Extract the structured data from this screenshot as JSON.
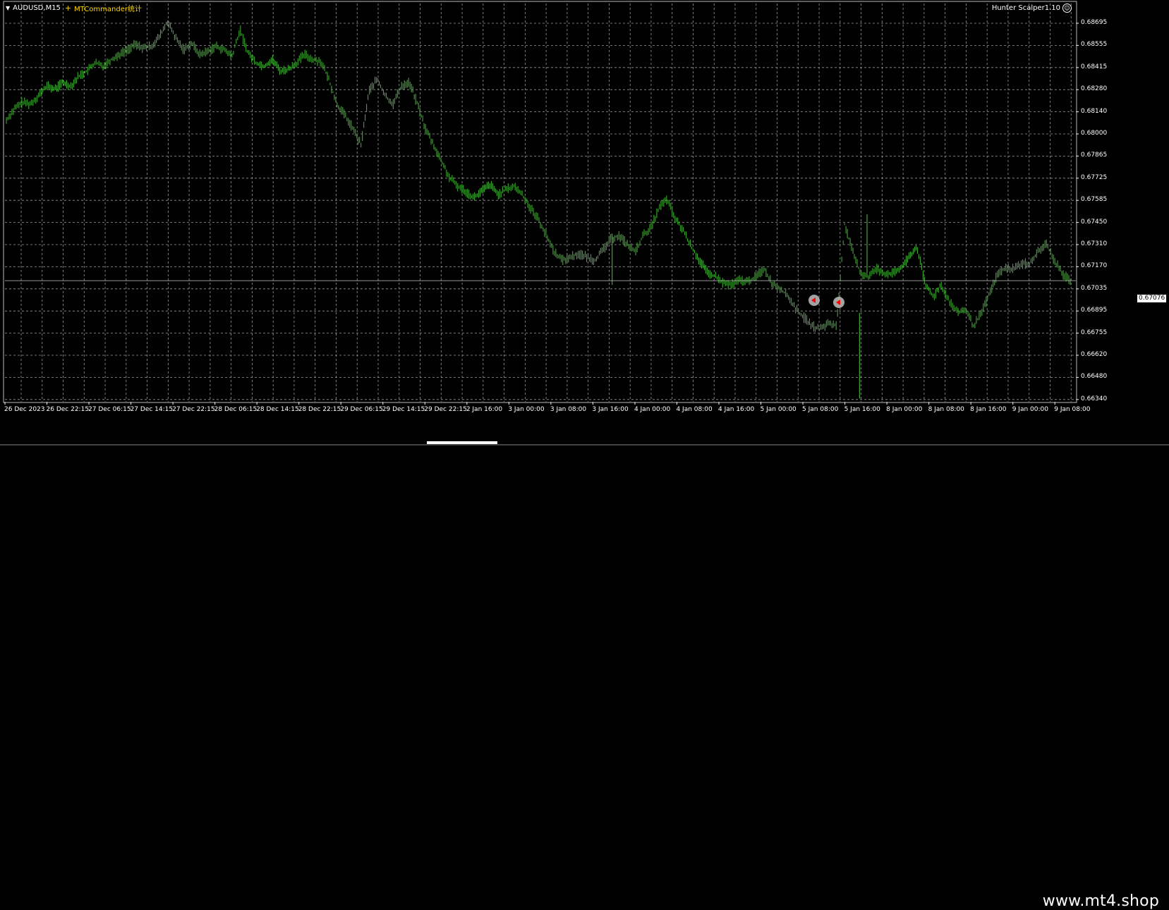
{
  "chart": {
    "symbol": "AUDUSD,M15",
    "expert_name": "MTCommander统计",
    "indicator_name": "Hunter Scalper1.10",
    "current_price": "0.67076",
    "colors": {
      "background": "#000000",
      "grid": "#9a9a9a",
      "candles": "#3fa832",
      "axis_text": "#ffffff",
      "expert_text": "#ffd700",
      "bid_line": "#aaaaaa",
      "trade_marker": "#c0c0c0",
      "trade_marker_arrow": "#ff0000"
    }
  },
  "chart_data": {
    "type": "line",
    "title": "",
    "ylim": [
      0.6634,
      0.6876
    ],
    "y_ticks": [
      "0.68695",
      "0.68555",
      "0.68415",
      "0.68280",
      "0.68140",
      "0.68000",
      "0.67865",
      "0.67725",
      "0.67585",
      "0.67450",
      "0.67310",
      "0.67170",
      "0.67035",
      "0.66895",
      "0.66755",
      "0.66620",
      "0.66480",
      "0.66340"
    ],
    "x_ticks": [
      "26 Dec 2023",
      "26 Dec 22:15",
      "27 Dec 06:15",
      "27 Dec 14:15",
      "27 Dec 22:15",
      "28 Dec 06:15",
      "28 Dec 14:15",
      "28 Dec 22:15",
      "29 Dec 06:15",
      "29 Dec 14:15",
      "29 Dec 22:15",
      "2 Jan 16:00",
      "3 Jan 00:00",
      "3 Jan 08:00",
      "3 Jan 16:00",
      "4 Jan 00:00",
      "4 Jan 08:00",
      "4 Jan 16:00",
      "5 Jan 00:00",
      "5 Jan 08:00",
      "5 Jan 16:00",
      "8 Jan 00:00",
      "8 Jan 08:00",
      "8 Jan 16:00",
      "9 Jan 00:00",
      "9 Jan 08:00"
    ],
    "series": [
      {
        "values": [
          0.6805,
          0.6812,
          0.6816,
          0.6815,
          0.682,
          0.6826,
          0.6824,
          0.6828,
          0.6826,
          0.6832,
          0.6835,
          0.684,
          0.6838,
          0.6842,
          0.6845,
          0.6848,
          0.6851,
          0.6849,
          0.685,
          0.6856,
          0.6865,
          0.6855,
          0.6848,
          0.6852,
          0.6845,
          0.6847,
          0.685,
          0.6848,
          0.6844,
          0.686,
          0.6846,
          0.684,
          0.6838,
          0.6842,
          0.6835,
          0.6836,
          0.684,
          0.6845,
          0.6842,
          0.6841,
          0.683,
          0.6815,
          0.6808,
          0.68,
          0.679,
          0.6823,
          0.683,
          0.682,
          0.6815,
          0.6826,
          0.6828,
          0.6815,
          0.68,
          0.679,
          0.678,
          0.677,
          0.6765,
          0.6762,
          0.6758,
          0.6762,
          0.6766,
          0.676,
          0.6763,
          0.6765,
          0.676,
          0.6752,
          0.6745,
          0.6735,
          0.6725,
          0.672,
          0.6722,
          0.6724,
          0.6722,
          0.672,
          0.6726,
          0.6733,
          0.6735,
          0.673,
          0.6725,
          0.6735,
          0.674,
          0.6752,
          0.6757,
          0.6745,
          0.6738,
          0.6728,
          0.672,
          0.6712,
          0.671,
          0.6706,
          0.6705,
          0.6708,
          0.6707,
          0.671,
          0.6715,
          0.6706,
          0.6703,
          0.6698,
          0.669,
          0.6685,
          0.668,
          0.6678,
          0.6682,
          0.668,
          0.6742,
          0.6725,
          0.6712,
          0.671,
          0.6715,
          0.6712,
          0.6712,
          0.6715,
          0.6722,
          0.6728,
          0.6705,
          0.6698,
          0.6705,
          0.6695,
          0.6688,
          0.669,
          0.668,
          0.6688,
          0.67,
          0.6712,
          0.6715,
          0.6715,
          0.6718,
          0.6718,
          0.6725,
          0.673,
          0.672,
          0.6712,
          0.6708
        ]
      }
    ]
  },
  "footer": {
    "watermark": "www.mt4.shop"
  }
}
